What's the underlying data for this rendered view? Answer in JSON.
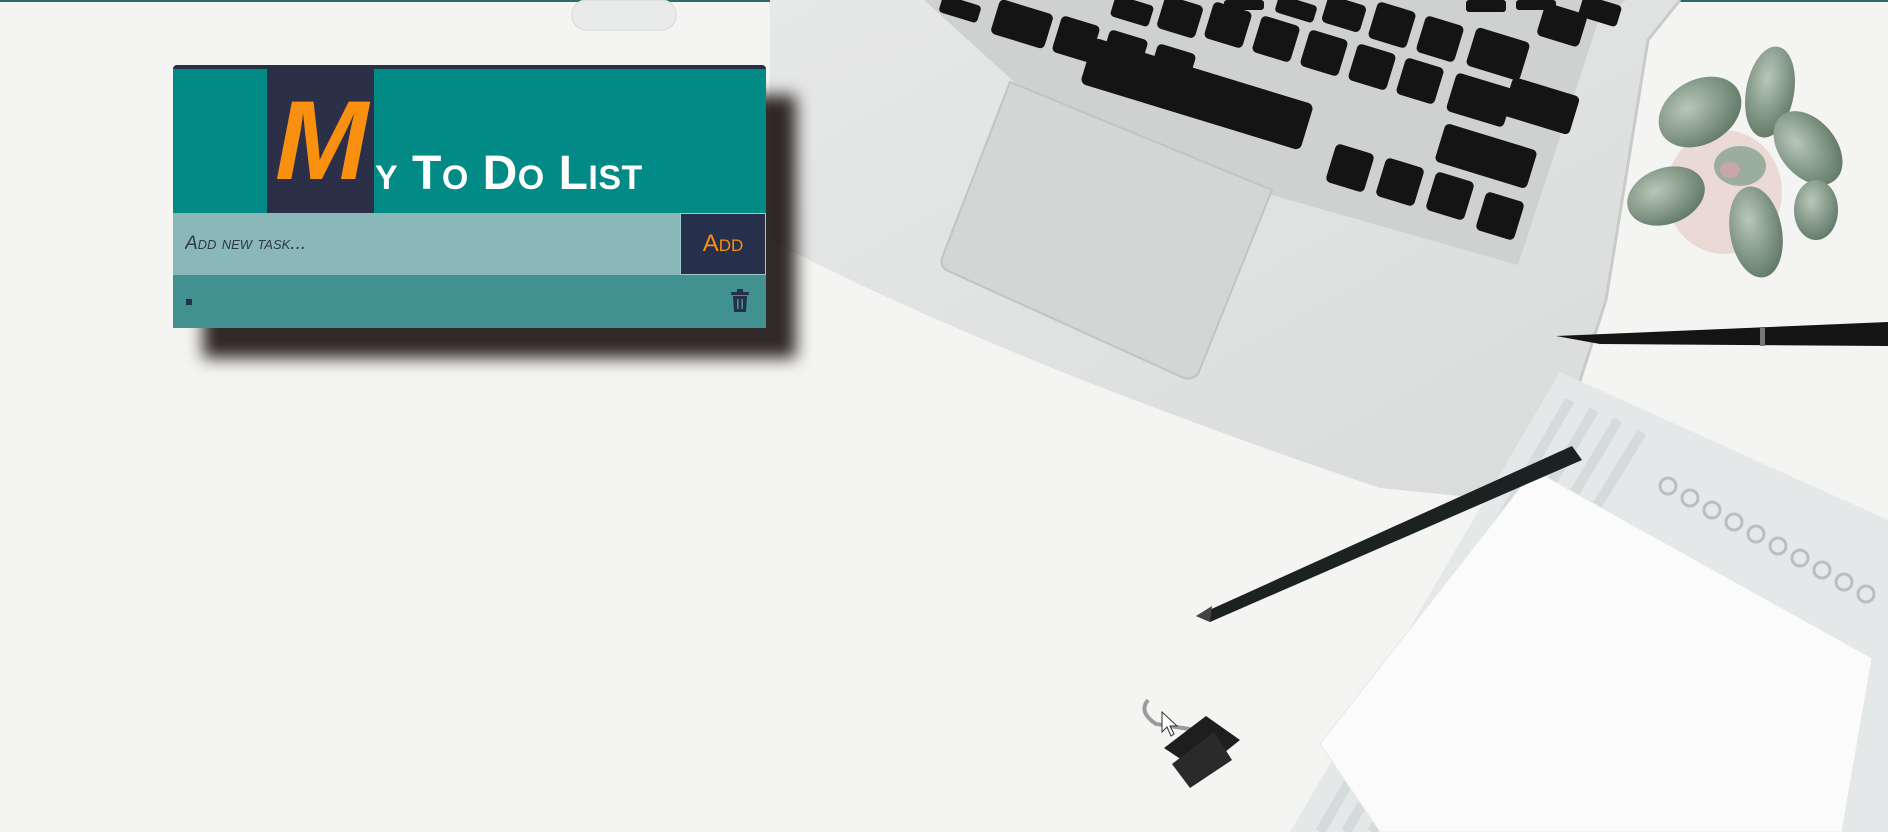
{
  "app": {
    "title_initial": "M",
    "title_rest": "y To Do List"
  },
  "input": {
    "placeholder": "Add new task...",
    "value": ""
  },
  "add_button": {
    "label": "Add"
  },
  "tasks": [
    {
      "text": ""
    }
  ],
  "colors": {
    "header": "#028a87",
    "title_block": "#2b2f48",
    "accent_orange": "#f9900f",
    "input_bg": "#8ab8b9",
    "task_row": "#429191",
    "button_bg": "#26304a"
  },
  "icons": {
    "delete": "trash-icon",
    "cursor": "mouse-pointer-icon"
  }
}
